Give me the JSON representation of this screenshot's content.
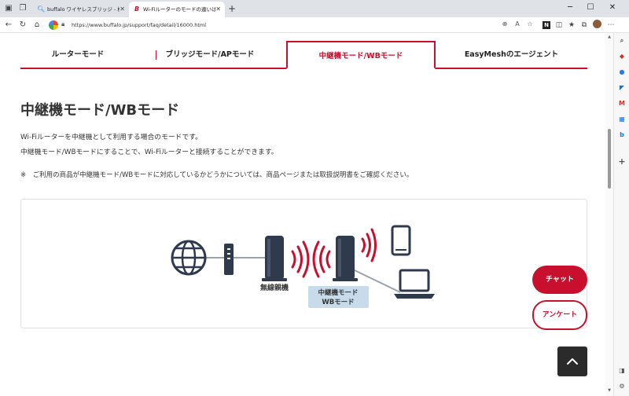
{
  "browser": {
    "tabs": [
      {
        "label": "buffalo ワイヤレスブリッジ - 検索",
        "active": false,
        "favicon": "search-icon"
      },
      {
        "label": "Wi-Fiルーターのモードの違いは何ですか",
        "active": true,
        "favicon": "buffalo-icon"
      }
    ],
    "url": "https://www.buffalo.jp/support/faq/detail/16000.html"
  },
  "page": {
    "mode_tabs": [
      {
        "label": "ルーターモード",
        "active": false
      },
      {
        "label": "ブリッジモード/APモード",
        "active": false
      },
      {
        "label": "中継機モード/WBモード",
        "active": true
      },
      {
        "label": "EasyMeshのエージェント",
        "active": false
      }
    ],
    "title": "中継機モード/WBモード",
    "desc_line1": "Wi-Fiルーターを中継機として利用する場合のモードです。",
    "desc_line2": "中継機モード/WBモードにすることで、Wi-Fiルーターと接続することができます。",
    "note": "※　ご利用の商品が中継機モード/WBモードに対応しているかどうかについては、商品ページまたは取扱説明書をご確認ください。",
    "diagram": {
      "parent_label": "無線親機",
      "repeater_label_1": "中継機モード",
      "repeater_label_2": "WBモード"
    },
    "chat_label": "チャット",
    "survey_label": "アンケート"
  },
  "colors": {
    "accent": "#c8102e",
    "device": "#2f3a4d",
    "label_bg": "#c7dbea"
  }
}
